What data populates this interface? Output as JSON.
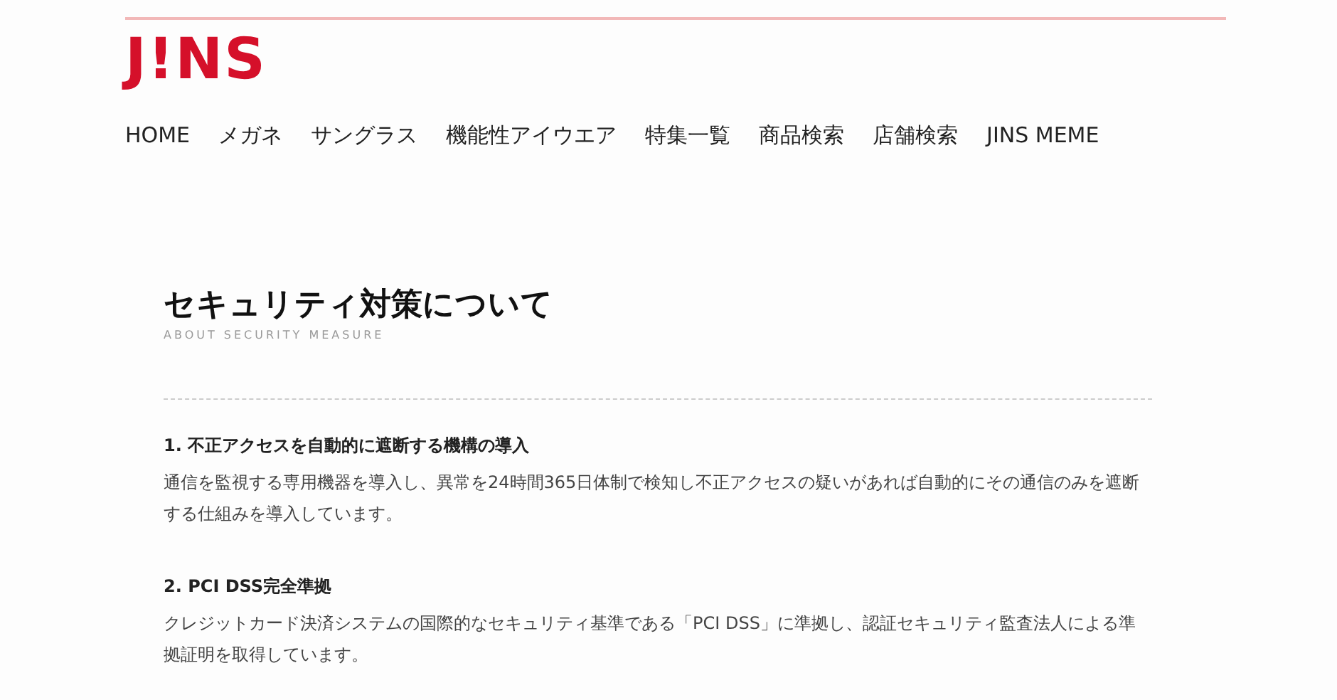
{
  "header": {
    "logo": "J!NS",
    "nav": [
      {
        "label": "HOME"
      },
      {
        "label": "メガネ"
      },
      {
        "label": "サングラス"
      },
      {
        "label": "機能性アイウエア"
      },
      {
        "label": "特集一覧"
      },
      {
        "label": "商品検索"
      },
      {
        "label": "店舗検索"
      },
      {
        "label": "JINS MEME"
      }
    ]
  },
  "page": {
    "title": "セキュリティ対策について",
    "subtitle": "ABOUT SECURITY MEASURE",
    "sections": [
      {
        "heading": "1. 不正アクセスを自動的に遮断する機構の導入",
        "body": "通信を監視する専用機器を導入し、異常を24時間365日体制で検知し不正アクセスの疑いがあれば自動的にその通信のみを遮断する仕組みを導入しています。"
      },
      {
        "heading": "2. PCI DSS完全準拠",
        "body": "クレジットカード決済システムの国際的なセキュリティ基準である「PCI DSS」に準拠し、認証セキュリティ監査法人による準拠証明を取得しています。"
      }
    ]
  }
}
